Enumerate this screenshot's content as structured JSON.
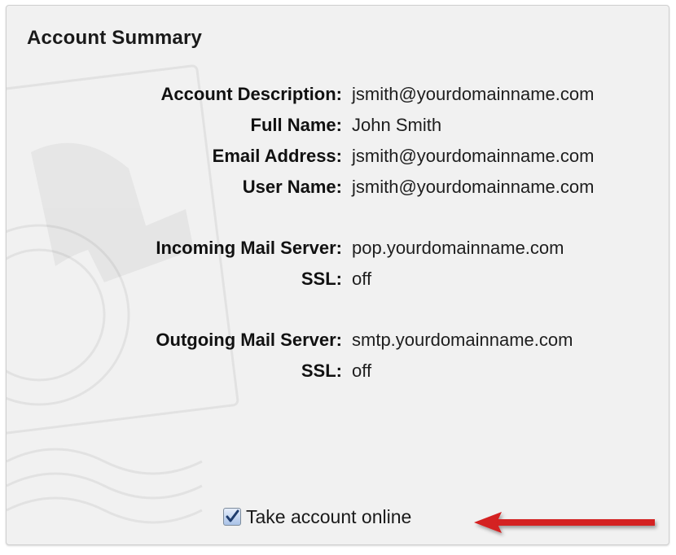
{
  "title": "Account Summary",
  "rows": [
    {
      "label": "Account Description:",
      "value": "jsmith@yourdomainname.com"
    },
    {
      "label": "Full Name:",
      "value": "John Smith"
    },
    {
      "label": "Email Address:",
      "value": "jsmith@yourdomainname.com"
    },
    {
      "label": "User Name:",
      "value": "jsmith@yourdomainname.com"
    },
    {
      "label": "Incoming Mail Server:",
      "value": "pop.yourdomainname.com"
    },
    {
      "label": "SSL:",
      "value": "off"
    },
    {
      "label": "Outgoing Mail Server:",
      "value": "smtp.yourdomainname.com"
    },
    {
      "label": "SSL:",
      "value": "off"
    }
  ],
  "take_online": {
    "label": "Take account online",
    "checked": true
  },
  "colors": {
    "arrow": "#d42020",
    "checkbox_fill": "#a9c2e8",
    "check_mark": "#1f3d6e"
  },
  "icons": {
    "checkbox": "checkmark-icon",
    "arrow": "left-arrow-icon",
    "background": "postage-stamp-watermark"
  }
}
